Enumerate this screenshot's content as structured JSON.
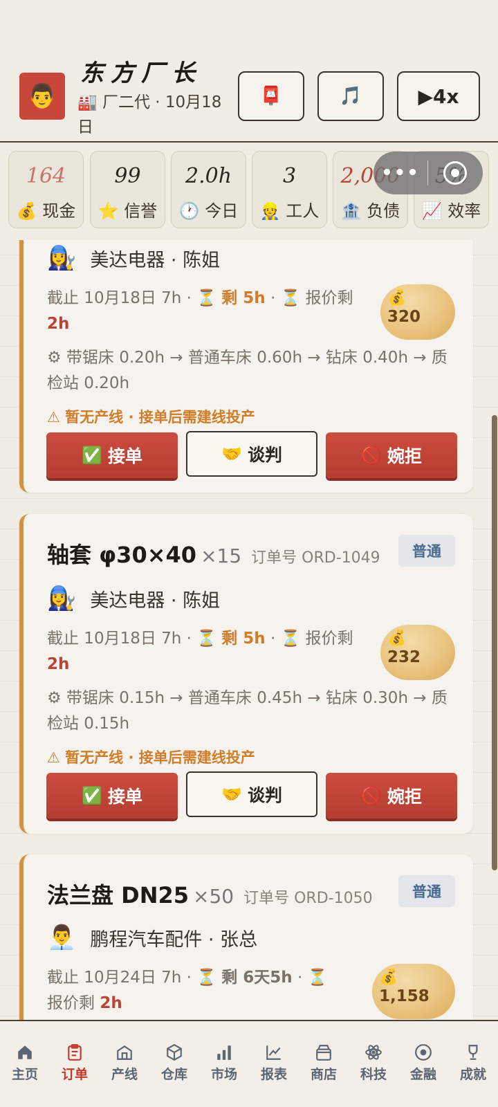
{
  "header": {
    "avatar_icon": "👨",
    "title": "东方厂长",
    "subtitle": "🏭 厂二代 · 10月18日",
    "mail_icon": "📮",
    "music_icon": "🎵",
    "speed_label": "▶4x"
  },
  "stats": [
    {
      "value": "164",
      "label": "💰 现金"
    },
    {
      "value": "99",
      "label": "⭐ 信誉"
    },
    {
      "value": "2.0h",
      "label": "🕐 今日"
    },
    {
      "value": "3",
      "label": "👷 工人"
    },
    {
      "value": "2,000",
      "label": "🏦 负债"
    },
    {
      "value": "5%",
      "label": "📈 效率"
    }
  ],
  "capsule": {
    "dots": "•••"
  },
  "orders": [
    {
      "client_icon": "👩‍🔧",
      "client": "美达电器 · 陈姐",
      "deadline_prefix": "截止 10月18日 7h · ⏳ ",
      "remain": "剩 5h",
      "quote_prefix": " · ⏳ 报价剩 ",
      "quote": "2h",
      "price_icon": "💰",
      "price": "320",
      "route": "⚙ 带锯床 0.20h → 普通车床 0.60h → 钻床 0.40h → 质检站 0.20h",
      "warning": "⚠ 暂无产线 · 接单后需建线投产",
      "accept": "接单",
      "negotiate": "谈判",
      "reject": "婉拒"
    },
    {
      "title": "轴套 φ30×40",
      "qty": "×15",
      "order_no": "订单号 ORD-1049",
      "badge": "普通",
      "client_icon": "👩‍🔧",
      "client": "美达电器 · 陈姐",
      "deadline_prefix": "截止 10月18日 7h · ⏳ ",
      "remain": "剩 5h",
      "quote_prefix": " · ⏳ 报价剩 ",
      "quote": "2h",
      "price_icon": "💰",
      "price": "232",
      "route": "⚙ 带锯床 0.15h → 普通车床 0.45h → 钻床 0.30h → 质检站 0.15h",
      "warning": "⚠ 暂无产线 · 接单后需建线投产",
      "accept": "接单",
      "negotiate": "谈判",
      "reject": "婉拒"
    },
    {
      "title": "法兰盘 DN25",
      "qty": "×50",
      "order_no": "订单号 ORD-1050",
      "badge": "普通",
      "client_icon": "👨‍💼",
      "client": "鹏程汽车配件 · 张总",
      "deadline_prefix": "截止 10月24日 7h · ⏳ ",
      "remain": "剩 6天5h",
      "quote_prefix": " · ⏳ 报价剩 ",
      "quote": "2h",
      "price_icon": "💰",
      "price": "1,158"
    }
  ],
  "button_icons": {
    "accept": "✅",
    "negotiate": "🤝",
    "reject": "🚫"
  },
  "tabs": [
    {
      "label": "主页",
      "icon": "home-icon"
    },
    {
      "label": "订单",
      "icon": "clipboard-icon",
      "active": true
    },
    {
      "label": "产线",
      "icon": "factory-icon"
    },
    {
      "label": "仓库",
      "icon": "box-icon"
    },
    {
      "label": "市场",
      "icon": "bar-chart-icon"
    },
    {
      "label": "报表",
      "icon": "line-chart-icon"
    },
    {
      "label": "商店",
      "icon": "shop-icon"
    },
    {
      "label": "科技",
      "icon": "atom-icon"
    },
    {
      "label": "金融",
      "icon": "coin-icon"
    },
    {
      "label": "成就",
      "icon": "trophy-icon"
    }
  ],
  "colors": {
    "accent": "#c0392b",
    "card_border": "#d4913e",
    "badge_text": "#4a6a8f"
  }
}
